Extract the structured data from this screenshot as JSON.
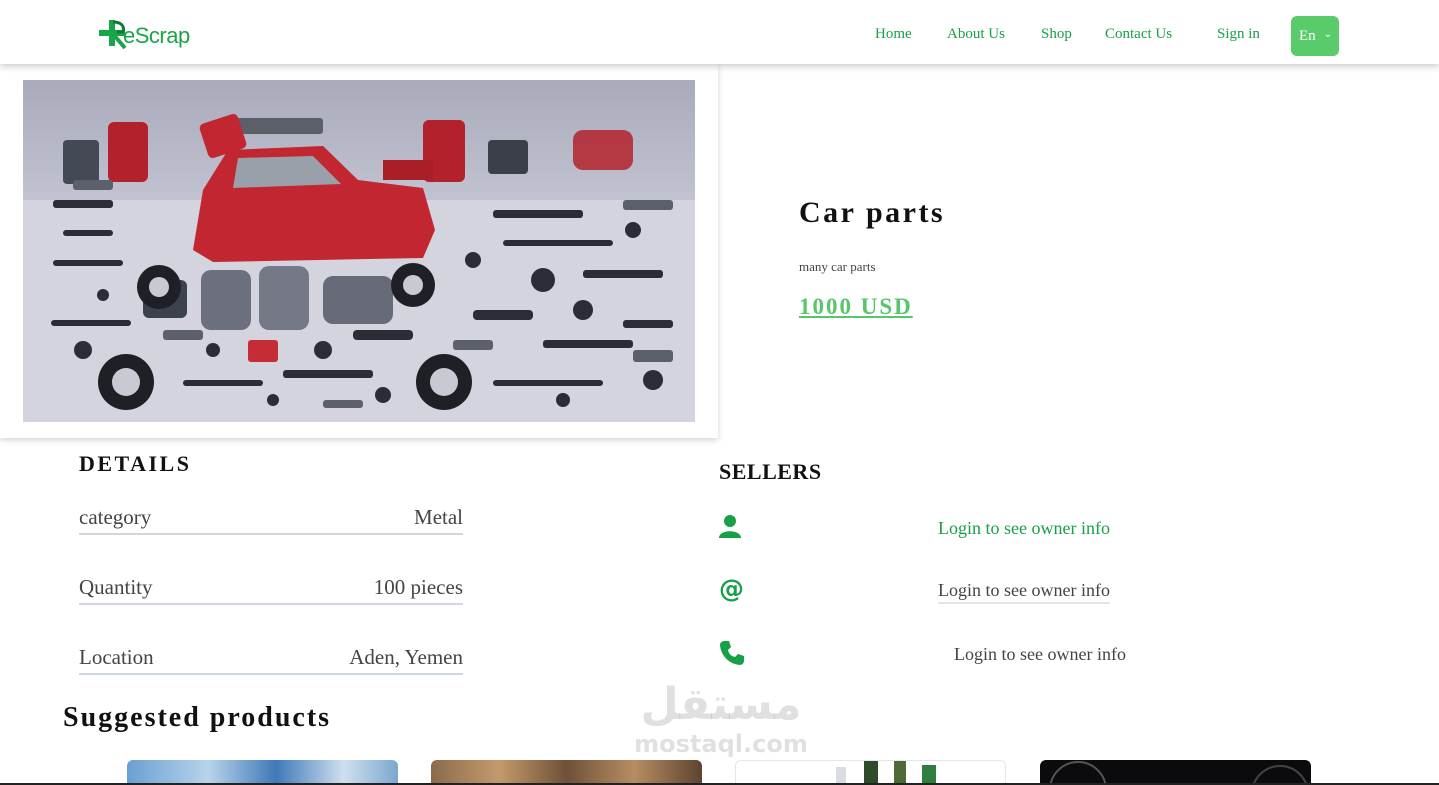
{
  "header": {
    "brand": "eScrap",
    "nav": {
      "home": "Home",
      "about": "About Us",
      "shop": "Shop",
      "contact": "Contact Us",
      "signin": "Sign in"
    },
    "language": "En"
  },
  "product": {
    "title": "Car parts",
    "description": "many car parts",
    "price": "1000 USD"
  },
  "details": {
    "heading": "DETAILS",
    "rows": [
      {
        "label": "category",
        "value": "Metal"
      },
      {
        "label": "Quantity",
        "value": "100 pieces"
      },
      {
        "label": "Location",
        "value": "Aden, Yemen"
      }
    ]
  },
  "sellers": {
    "heading": "SELLERS",
    "items": [
      {
        "icon": "user-icon",
        "text": "Login to see owner info"
      },
      {
        "icon": "at-sign-icon",
        "text": "Login to see owner info"
      },
      {
        "icon": "phone-icon",
        "text": "Login to see owner info"
      }
    ]
  },
  "suggested": {
    "heading": "Suggested products"
  },
  "watermark": {
    "arabic": "مستقل",
    "latin": "mostaql.com"
  },
  "colors": {
    "brand_green": "#18a048",
    "price_green": "#57c56a",
    "lang_button": "#5acb6b"
  }
}
